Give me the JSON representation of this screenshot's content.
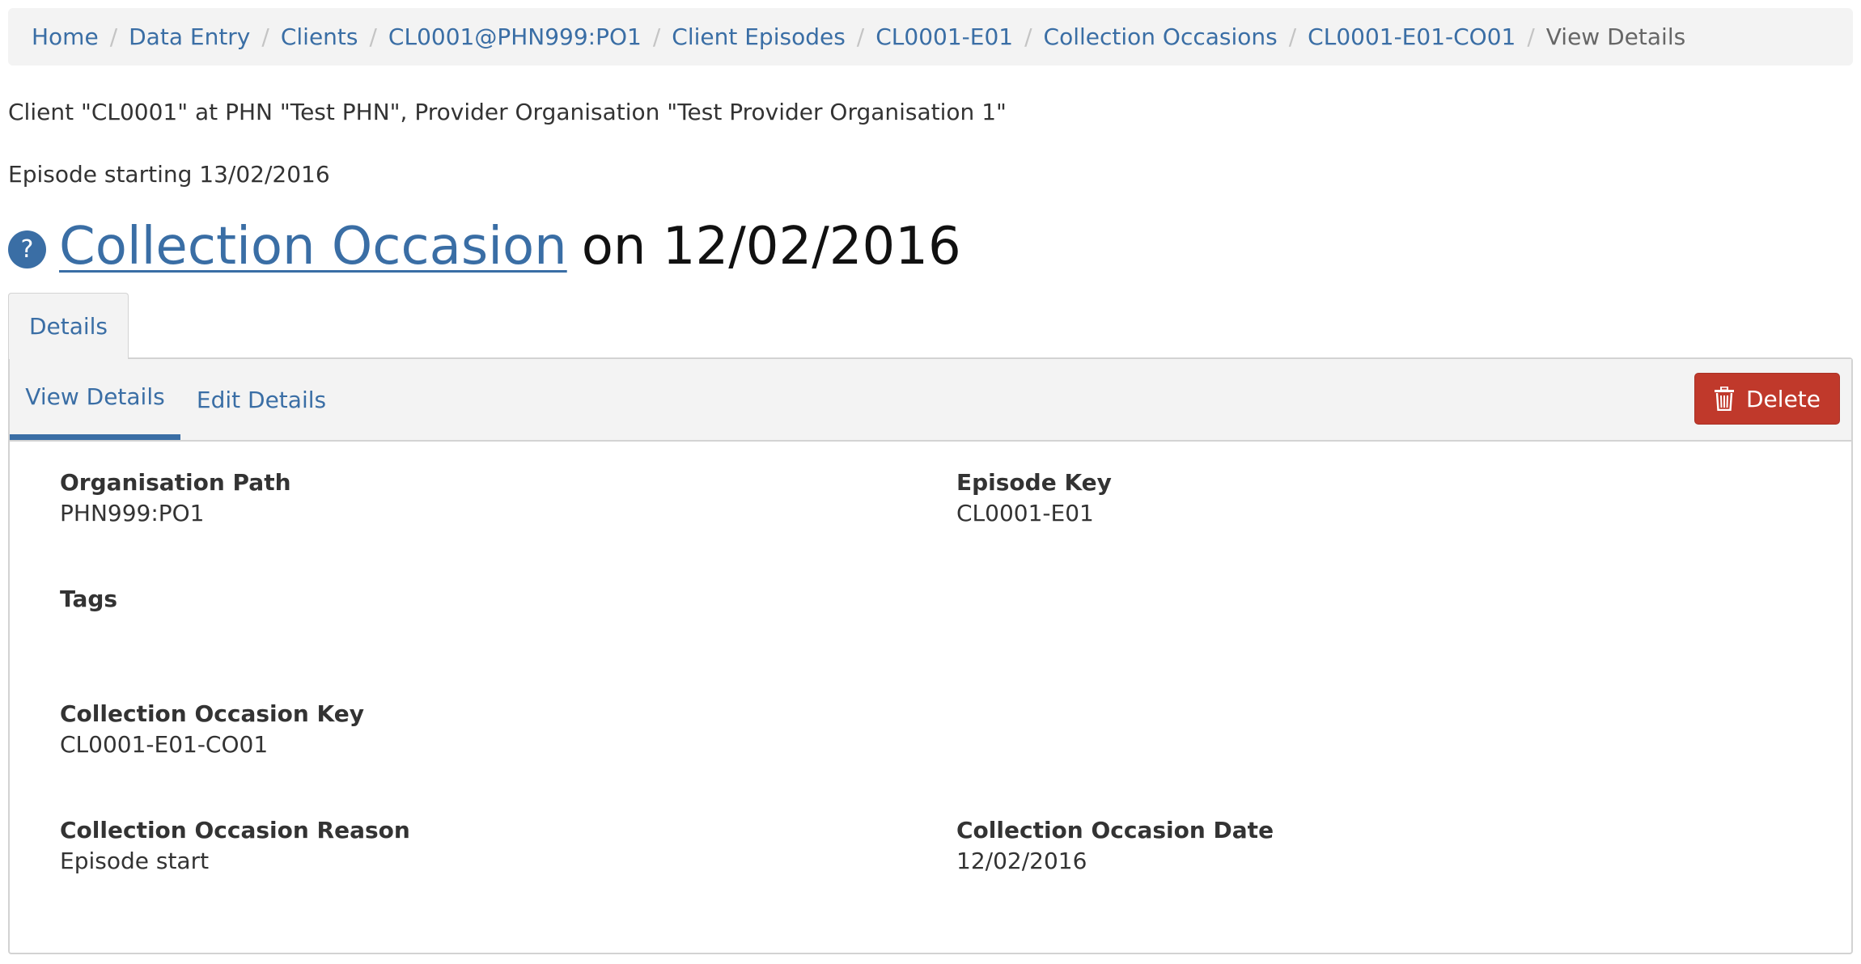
{
  "breadcrumb": {
    "items": [
      {
        "label": "Home"
      },
      {
        "label": "Data Entry"
      },
      {
        "label": "Clients"
      },
      {
        "label": "CL0001@PHN999:PO1"
      },
      {
        "label": "Client Episodes"
      },
      {
        "label": "CL0001-E01"
      },
      {
        "label": "Collection Occasions"
      },
      {
        "label": "CL0001-E01-CO01"
      }
    ],
    "separator": "/",
    "current": "View Details"
  },
  "context": {
    "client_line": "Client \"CL0001\" at PHN \"Test PHN\", Provider Organisation \"Test Provider Organisation 1\"",
    "episode_line": "Episode starting 13/02/2016"
  },
  "heading": {
    "help_icon": "question-circle-icon",
    "help_glyph": "?",
    "link_text": "Collection Occasion",
    "rest_text": "on 12/02/2016"
  },
  "tabs": {
    "outer": "Details",
    "view": "View Details",
    "edit": "Edit Details"
  },
  "actions": {
    "delete_label": "Delete",
    "delete_icon": "trash-icon",
    "delete_color": "#c0392b"
  },
  "fields": {
    "organisation_path": {
      "label": "Organisation Path",
      "value": "PHN999:PO1"
    },
    "episode_key": {
      "label": "Episode Key",
      "value": "CL0001-E01"
    },
    "tags": {
      "label": "Tags",
      "value": ""
    },
    "collection_occasion_key": {
      "label": "Collection Occasion Key",
      "value": "CL0001-E01-CO01"
    },
    "collection_occasion_reason": {
      "label": "Collection Occasion Reason",
      "value": "Episode start"
    },
    "collection_occasion_date": {
      "label": "Collection Occasion Date",
      "value": "12/02/2016"
    }
  },
  "colors": {
    "link": "#3a6ea5",
    "panel_bg": "#f3f3f3",
    "border": "#d3d3d3"
  }
}
